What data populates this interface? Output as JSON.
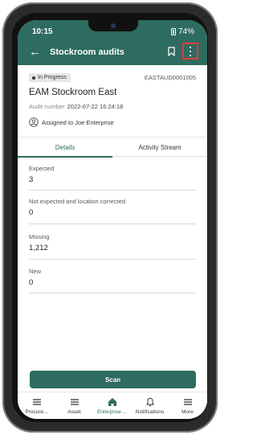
{
  "status_bar": {
    "time": "10:15",
    "battery": "74%"
  },
  "header": {
    "title": "Stockroom audits",
    "back_icon": "arrow-left-icon",
    "bookmark_icon": "bookmark-icon",
    "more_icon": "more-vertical-icon"
  },
  "record": {
    "status": "In Progress",
    "id": "EASTAUD0001005",
    "title": "EAM Stockroom East",
    "audit_label": "Audit number",
    "audit_value": "2022-07-22 16:24:18",
    "assigned": "Assigned to Joe Enterprise"
  },
  "tabs": [
    {
      "label": "Details",
      "active": true
    },
    {
      "label": "Activity Stream",
      "active": false
    }
  ],
  "fields": [
    {
      "label": "Expected",
      "value": "3"
    },
    {
      "label": "Not expected and location corrected",
      "value": "0"
    },
    {
      "label": "Missing",
      "value": "1,212"
    },
    {
      "label": "New",
      "value": "0"
    }
  ],
  "scan_label": "Scan",
  "nav": [
    {
      "label": "Procure...",
      "icon": "menu-icon"
    },
    {
      "label": "Asset",
      "icon": "menu-icon"
    },
    {
      "label": "Enterprise ...",
      "icon": "home-icon",
      "active": true
    },
    {
      "label": "Notifications",
      "icon": "bell-icon"
    },
    {
      "label": "More",
      "icon": "menu-icon"
    }
  ],
  "colors": {
    "accent": "#2e6b60",
    "highlight": "#e53935"
  }
}
